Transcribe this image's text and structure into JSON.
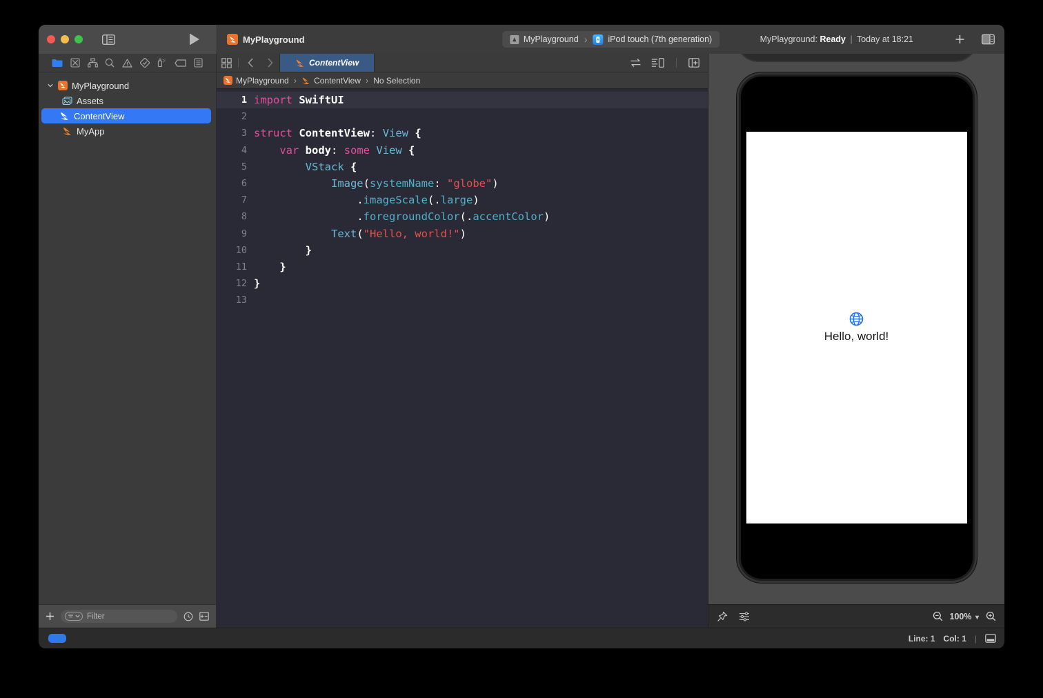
{
  "window": {
    "traffic_lights": [
      "close",
      "minimize",
      "zoom"
    ],
    "colors": {
      "close": "#f25a54",
      "minimize": "#f4bd4f",
      "zoom": "#3fc14b",
      "accent_blue": "#3478f6",
      "tab_active": "#3a5a86",
      "swift_orange": "#e8732c",
      "editor_bg": "#292a35",
      "keyword_pink": "#e64c9e",
      "type_blue": "#6bb8d6",
      "function_blue": "#4eb0cc",
      "string_red": "#e8504a"
    }
  },
  "toolbar": {
    "project_name": "MyPlayground",
    "sidebar_toggle_label": "Hide or show the Navigator",
    "run_label": "Run",
    "add_label": "+",
    "inspector_toggle_label": "Hide or show the Inspector",
    "scheme": {
      "project": "MyPlayground",
      "separator": "›",
      "destination": "iPod touch (7th generation)"
    },
    "activity": {
      "prefix": "MyPlayground:",
      "state": "Ready",
      "divider": "|",
      "timestamp": "Today at 18:21"
    }
  },
  "navigator": {
    "tabs": [
      {
        "name": "project-navigator",
        "icon": "folder-icon",
        "active": true
      },
      {
        "name": "source-control-navigator",
        "icon": "source-control-icon",
        "active": false
      },
      {
        "name": "symbol-navigator",
        "icon": "hierarchy-icon",
        "active": false
      },
      {
        "name": "find-navigator",
        "icon": "search-icon",
        "active": false
      },
      {
        "name": "issue-navigator",
        "icon": "warning-triangle-icon",
        "active": false
      },
      {
        "name": "test-navigator",
        "icon": "diamond-check-icon",
        "active": false
      },
      {
        "name": "debug-navigator",
        "icon": "spray-icon",
        "active": false
      },
      {
        "name": "breakpoint-navigator",
        "icon": "breakpoint-tag-icon",
        "active": false
      },
      {
        "name": "report-navigator",
        "icon": "report-list-icon",
        "active": false
      }
    ],
    "tree": [
      {
        "label": "MyPlayground",
        "icon": "swift-project-icon",
        "depth": 0,
        "expanded": true,
        "selected": false
      },
      {
        "label": "Assets",
        "icon": "assets-catalog-icon",
        "depth": 1,
        "expanded": null,
        "selected": false
      },
      {
        "label": "ContentView",
        "icon": "swift-file-icon",
        "depth": 1,
        "expanded": null,
        "selected": true
      },
      {
        "label": "MyApp",
        "icon": "swift-file-icon",
        "depth": 1,
        "expanded": null,
        "selected": false
      }
    ],
    "footer": {
      "add_label": "+",
      "filter_placeholder": "Filter",
      "recent_icon": "clock-icon",
      "source_control_icon": "plus-minus-icon"
    }
  },
  "editor": {
    "tabbar": {
      "grid_icon": "tab-grid-icon",
      "back_label": "‹",
      "forward_label": "›",
      "active_tab": "ContentView",
      "right_icons": [
        "code-review-icon",
        "editor-options-icon",
        "add-editor-icon"
      ]
    },
    "breadcrumb": [
      {
        "label": "MyPlayground",
        "icon": "swift-project-icon"
      },
      {
        "label": "ContentView",
        "icon": "swift-file-icon"
      },
      {
        "label": "No Selection",
        "icon": null
      }
    ],
    "current_line": 1,
    "lines": [
      {
        "n": 1,
        "tokens": [
          {
            "t": "import",
            "c": "kw"
          },
          {
            "t": " ",
            "c": "ctext"
          },
          {
            "t": "SwiftUI",
            "c": "plain"
          }
        ]
      },
      {
        "n": 2,
        "tokens": []
      },
      {
        "n": 3,
        "tokens": [
          {
            "t": "struct",
            "c": "kw"
          },
          {
            "t": " ",
            "c": "ctext"
          },
          {
            "t": "ContentView",
            "c": "plain"
          },
          {
            "t": ":",
            "c": "punc"
          },
          {
            "t": " ",
            "c": "ctext"
          },
          {
            "t": "View",
            "c": "type"
          },
          {
            "t": " ",
            "c": "ctext"
          },
          {
            "t": "{",
            "c": "brc"
          }
        ]
      },
      {
        "n": 4,
        "tokens": [
          {
            "t": "    ",
            "c": "ctext"
          },
          {
            "t": "var",
            "c": "kw"
          },
          {
            "t": " ",
            "c": "ctext"
          },
          {
            "t": "body",
            "c": "plain"
          },
          {
            "t": ":",
            "c": "punc"
          },
          {
            "t": " ",
            "c": "ctext"
          },
          {
            "t": "some",
            "c": "kw"
          },
          {
            "t": " ",
            "c": "ctext"
          },
          {
            "t": "View",
            "c": "type"
          },
          {
            "t": " ",
            "c": "ctext"
          },
          {
            "t": "{",
            "c": "brc"
          }
        ]
      },
      {
        "n": 5,
        "tokens": [
          {
            "t": "        ",
            "c": "ctext"
          },
          {
            "t": "VStack",
            "c": "type"
          },
          {
            "t": " ",
            "c": "ctext"
          },
          {
            "t": "{",
            "c": "brc"
          }
        ]
      },
      {
        "n": 6,
        "tokens": [
          {
            "t": "            ",
            "c": "ctext"
          },
          {
            "t": "Image",
            "c": "type"
          },
          {
            "t": "(",
            "c": "punc"
          },
          {
            "t": "systemName",
            "c": "fn"
          },
          {
            "t": ": ",
            "c": "punc"
          },
          {
            "t": "\"globe\"",
            "c": "str"
          },
          {
            "t": ")",
            "c": "punc"
          }
        ]
      },
      {
        "n": 7,
        "tokens": [
          {
            "t": "                ",
            "c": "ctext"
          },
          {
            "t": ".",
            "c": "punc"
          },
          {
            "t": "imageScale",
            "c": "fn"
          },
          {
            "t": "(",
            "c": "punc"
          },
          {
            "t": ".",
            "c": "punc"
          },
          {
            "t": "large",
            "c": "fn"
          },
          {
            "t": ")",
            "c": "punc"
          }
        ]
      },
      {
        "n": 8,
        "tokens": [
          {
            "t": "                ",
            "c": "ctext"
          },
          {
            "t": ".",
            "c": "punc"
          },
          {
            "t": "foregroundColor",
            "c": "fn"
          },
          {
            "t": "(",
            "c": "punc"
          },
          {
            "t": ".",
            "c": "punc"
          },
          {
            "t": "accentColor",
            "c": "fn"
          },
          {
            "t": ")",
            "c": "punc"
          }
        ]
      },
      {
        "n": 9,
        "tokens": [
          {
            "t": "            ",
            "c": "ctext"
          },
          {
            "t": "Text",
            "c": "type"
          },
          {
            "t": "(",
            "c": "punc"
          },
          {
            "t": "\"Hello, world!\"",
            "c": "str"
          },
          {
            "t": ")",
            "c": "punc"
          }
        ]
      },
      {
        "n": 10,
        "tokens": [
          {
            "t": "        ",
            "c": "ctext"
          },
          {
            "t": "}",
            "c": "brc"
          }
        ]
      },
      {
        "n": 11,
        "tokens": [
          {
            "t": "    ",
            "c": "ctext"
          },
          {
            "t": "}",
            "c": "brc"
          }
        ]
      },
      {
        "n": 12,
        "tokens": [
          {
            "t": "}",
            "c": "brc"
          }
        ]
      },
      {
        "n": 13,
        "tokens": []
      }
    ]
  },
  "canvas": {
    "device_name": "iPod touch (7th generation)",
    "preview": {
      "icon": "globe-icon",
      "glyph": "🌐",
      "text": "Hello, world!",
      "background": "#ffffff",
      "icon_color": "#1a72f2"
    },
    "bottom_bar": {
      "pin_icon": "pin-icon",
      "variants_icon": "preview-variants-icon",
      "zoom_out_icon": "zoom-out-icon",
      "zoom_level": "100%",
      "chevron": "⌄",
      "zoom_in_icon": "zoom-in-icon"
    }
  },
  "statusbar": {
    "left_chip": "blue-progress-chip",
    "line_label": "Line: 1",
    "col_label": "Col: 1",
    "divider": "|",
    "minimap_icon": "minimap-toggle-icon"
  }
}
